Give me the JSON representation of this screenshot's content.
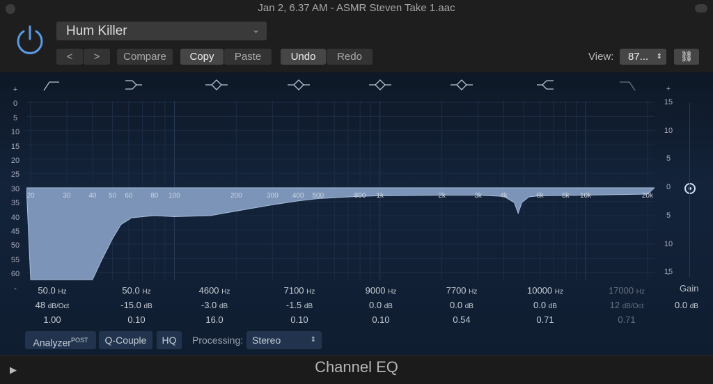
{
  "window": {
    "title": "Jan 2, 6.37 AM - ASMR Steven Take 1.aac",
    "plugin_name": "Channel EQ"
  },
  "header": {
    "preset": "Hum Killer",
    "prev": "<",
    "next": ">",
    "compare": "Compare",
    "copy": "Copy",
    "paste": "Paste",
    "undo": "Undo",
    "redo": "Redo",
    "view_label": "View:",
    "view_value": "87...",
    "power_color": "#5b9be6"
  },
  "axis": {
    "left": [
      "+",
      "0",
      "5",
      "10",
      "15",
      "20",
      "25",
      "30",
      "35",
      "40",
      "45",
      "50",
      "55",
      "60",
      "-"
    ],
    "right": [
      "+",
      "15",
      "10",
      "5",
      "0",
      "5",
      "10",
      "15",
      "-"
    ]
  },
  "freq_labels": [
    "20",
    "30",
    "40",
    "50",
    "60",
    "80",
    "100",
    "200",
    "300",
    "400",
    "500",
    "800",
    "1k",
    "2k",
    "3k",
    "4k",
    "6k",
    "8k",
    "10k",
    "20k"
  ],
  "freq_values": [
    20,
    30,
    40,
    50,
    60,
    80,
    100,
    200,
    300,
    400,
    500,
    800,
    1000,
    2000,
    3000,
    4000,
    6000,
    8000,
    10000,
    20000
  ],
  "band_icons": [
    "low-cut",
    "low-shelf",
    "bell",
    "bell",
    "bell",
    "bell",
    "high-shelf",
    "high-cut"
  ],
  "bands": [
    {
      "freq": "50.0",
      "fu": "Hz",
      "gain": "48",
      "gu": "dB/Oct",
      "q": "1.00",
      "enabled": true
    },
    {
      "freq": "50.0",
      "fu": "Hz",
      "gain": "-15.0",
      "gu": "dB",
      "q": "0.10",
      "enabled": true
    },
    {
      "freq": "4600",
      "fu": "Hz",
      "gain": "-3.0",
      "gu": "dB",
      "q": "16.0",
      "enabled": true
    },
    {
      "freq": "7100",
      "fu": "Hz",
      "gain": "-1.5",
      "gu": "dB",
      "q": "0.10",
      "enabled": true
    },
    {
      "freq": "9000",
      "fu": "Hz",
      "gain": "0.0",
      "gu": "dB",
      "q": "0.10",
      "enabled": true
    },
    {
      "freq": "7700",
      "fu": "Hz",
      "gain": "0.0",
      "gu": "dB",
      "q": "0.54",
      "enabled": true
    },
    {
      "freq": "10000",
      "fu": "Hz",
      "gain": "0.0",
      "gu": "dB",
      "q": "0.71",
      "enabled": true
    },
    {
      "freq": "17000",
      "fu": "Hz",
      "gain": "12",
      "gu": "dB/Oct",
      "q": "0.71",
      "enabled": false
    }
  ],
  "gain": {
    "label": "Gain",
    "value": "0.0",
    "unit": "dB"
  },
  "toolbar": {
    "analyzer": "Analyzer",
    "post": "POST",
    "qcouple": "Q-Couple",
    "hq": "HQ",
    "processing_label": "Processing:",
    "processing_value": "Stereo"
  },
  "curve": {
    "fill_color": "#7b94b8",
    "points": [
      [
        20,
        -16.3
      ],
      [
        40,
        -16.3
      ],
      [
        44,
        -13
      ],
      [
        50,
        -9
      ],
      [
        55,
        -6.5
      ],
      [
        62,
        -5.3
      ],
      [
        80,
        -4.9
      ],
      [
        100,
        -5.1
      ],
      [
        150,
        -4.9
      ],
      [
        200,
        -4.1
      ],
      [
        300,
        -3
      ],
      [
        400,
        -2.3
      ],
      [
        500,
        -1.9
      ],
      [
        800,
        -1.5
      ],
      [
        1000,
        -1.4
      ],
      [
        2000,
        -1.3
      ],
      [
        3000,
        -1.3
      ],
      [
        4000,
        -1.5
      ],
      [
        4500,
        -2.6
      ],
      [
        4700,
        -4.5
      ],
      [
        4900,
        -2.6
      ],
      [
        5300,
        -1.6
      ],
      [
        6000,
        -1.4
      ],
      [
        10000,
        -1.3
      ],
      [
        20000,
        -1.1
      ]
    ]
  }
}
